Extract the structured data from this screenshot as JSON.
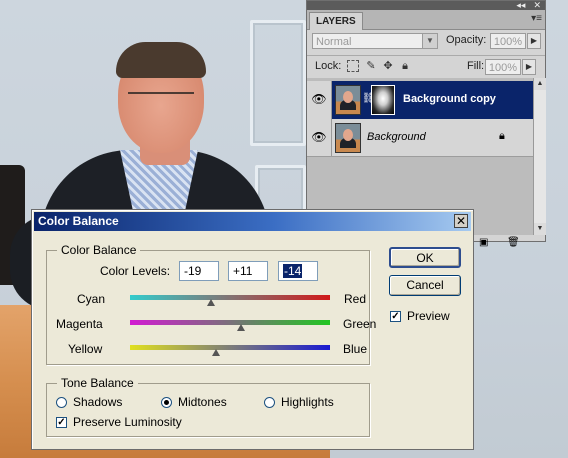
{
  "layers_panel": {
    "tab_label": "LAYERS",
    "blend_mode": "Normal",
    "opacity_label": "Opacity:",
    "opacity_value": "100%",
    "lock_label": "Lock:",
    "fill_label": "Fill:",
    "fill_value": "100%",
    "layers": [
      {
        "name": "Background copy",
        "selected": true,
        "has_mask": true
      },
      {
        "name": "Background",
        "selected": false,
        "locked": true
      }
    ]
  },
  "dialog": {
    "title": "Color Balance",
    "color_balance_group": "Color Balance",
    "color_levels_label": "Color Levels:",
    "levels": [
      "-19",
      "+11",
      "-14"
    ],
    "sliders": [
      {
        "left": "Cyan",
        "right": "Red",
        "value": -19,
        "colors": [
          "#33cccc",
          "#d11a1a"
        ]
      },
      {
        "left": "Magenta",
        "right": "Green",
        "value": 11,
        "colors": [
          "#d21ad2",
          "#22c622"
        ]
      },
      {
        "left": "Yellow",
        "right": "Blue",
        "value": -14,
        "colors": [
          "#e0e01f",
          "#1a1ad2"
        ]
      }
    ],
    "ok_label": "OK",
    "cancel_label": "Cancel",
    "preview_label": "Preview",
    "preview_checked": true,
    "tone_group": "Tone Balance",
    "tones": [
      {
        "label": "Shadows",
        "selected": false
      },
      {
        "label": "Midtones",
        "selected": true
      },
      {
        "label": "Highlights",
        "selected": false
      }
    ],
    "preserve_label": "Preserve Luminosity",
    "preserve_checked": true
  }
}
